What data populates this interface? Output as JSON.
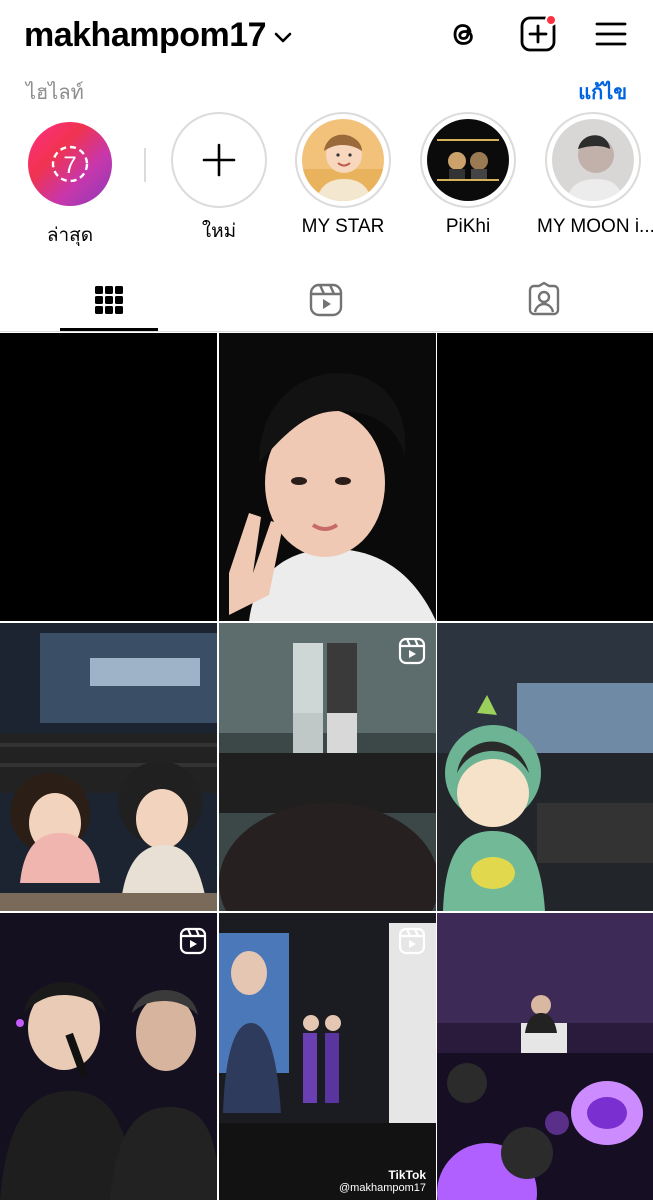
{
  "header": {
    "username": "makhampom17",
    "icons": [
      "threads-icon",
      "new-post-icon",
      "menu-icon"
    ]
  },
  "highlights_section": {
    "label": "ไฮไลท์",
    "edit_label": "แก้ไข"
  },
  "highlights": [
    {
      "name": "ล่าสุด",
      "badge": "7"
    },
    {
      "name": "ใหม่"
    },
    {
      "name": "MY STAR"
    },
    {
      "name": "PiKhi"
    },
    {
      "name": "MY MOON i..."
    }
  ],
  "tabs": [
    "grid-icon",
    "reels-icon",
    "tagged-icon"
  ],
  "grid": {
    "posts": [
      {
        "type": "photo"
      },
      {
        "type": "photo"
      },
      {
        "type": "photo"
      },
      {
        "type": "photo"
      },
      {
        "type": "reel"
      },
      {
        "type": "photo"
      },
      {
        "type": "reel"
      },
      {
        "type": "reel",
        "watermark_brand": "TikTok",
        "watermark_handle": "@makhampom17"
      },
      {
        "type": "photo"
      }
    ]
  },
  "colors": {
    "link": "#0064e0",
    "notification": "#ff3040",
    "border": "#dbdbdb",
    "muted": "#8e8e8e"
  }
}
